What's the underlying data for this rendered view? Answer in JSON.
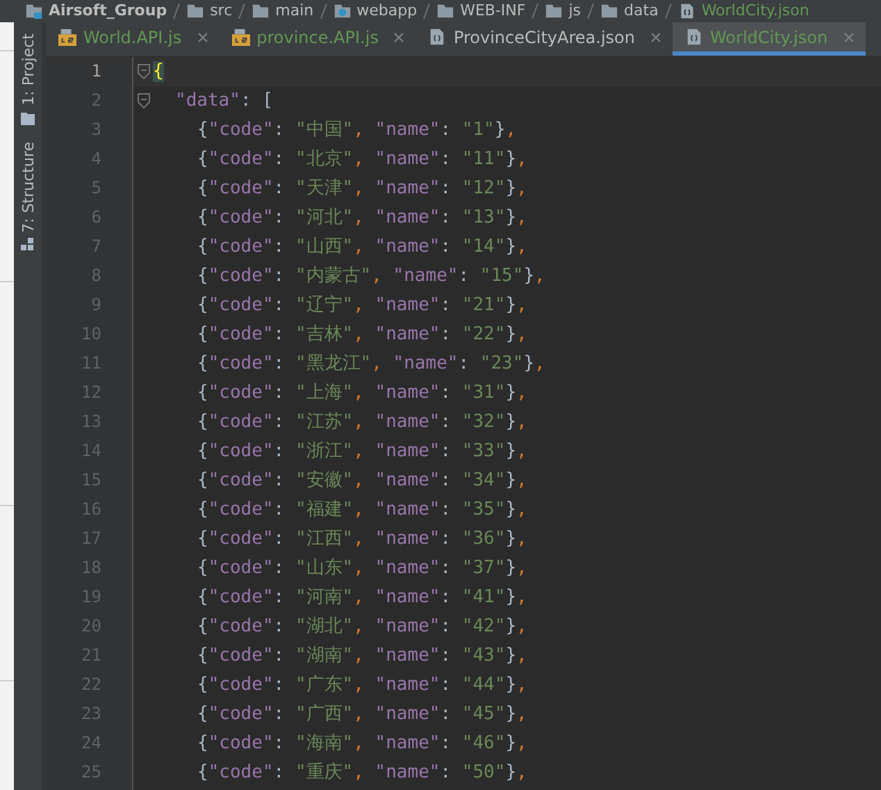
{
  "breadcrumb": [
    {
      "kind": "module",
      "label": "Airsoft_Group"
    },
    {
      "kind": "folder",
      "label": "src"
    },
    {
      "kind": "folder",
      "label": "main"
    },
    {
      "kind": "web",
      "label": "webapp"
    },
    {
      "kind": "folder",
      "label": "WEB-INF"
    },
    {
      "kind": "folder",
      "label": "js"
    },
    {
      "kind": "folder",
      "label": "data"
    },
    {
      "kind": "file",
      "label": "WorldCity.json"
    }
  ],
  "tool_strip": [
    {
      "kind": "project",
      "label": "1: Project"
    },
    {
      "kind": "structure",
      "label": "7: Structure"
    }
  ],
  "tabs": [
    {
      "kind": "js",
      "label": "World.API.js",
      "color": "#629755",
      "selected": false
    },
    {
      "kind": "js",
      "label": "province.API.js",
      "color": "#629755",
      "selected": false
    },
    {
      "kind": "json",
      "label": "ProvinceCityArea.json",
      "color": "#bbbbbb",
      "selected": false
    },
    {
      "kind": "json",
      "label": "WorldCity.json",
      "color": "#629755",
      "selected": true
    }
  ],
  "editor": {
    "lines": [
      {
        "number": "1",
        "current": true,
        "foldable": true,
        "kind": "root",
        "tokens": [
          {
            "kind": "brace-match",
            "text": "{"
          }
        ]
      },
      {
        "number": "2",
        "current": false,
        "foldable": true,
        "kind": "key",
        "tokens": [
          {
            "kind": "key",
            "text": "\"data\""
          },
          {
            "kind": "punct",
            "text": ": ["
          }
        ]
      },
      {
        "number": "3",
        "current": false,
        "foldable": false,
        "kind": "entry",
        "tokens": [
          {
            "kind": "punct",
            "text": "{"
          },
          {
            "kind": "key",
            "text": "\"code\""
          },
          {
            "kind": "punct",
            "text": ": "
          },
          {
            "kind": "string",
            "text": "\"中国\""
          },
          {
            "kind": "comma",
            "text": ", "
          },
          {
            "kind": "key",
            "text": "\"name\""
          },
          {
            "kind": "punct",
            "text": ": "
          },
          {
            "kind": "string",
            "text": "\"1\""
          },
          {
            "kind": "punct",
            "text": "}"
          },
          {
            "kind": "comma",
            "text": ","
          }
        ]
      },
      {
        "number": "4",
        "current": false,
        "foldable": false,
        "kind": "entry",
        "tokens": [
          {
            "kind": "punct",
            "text": "{"
          },
          {
            "kind": "key",
            "text": "\"code\""
          },
          {
            "kind": "punct",
            "text": ": "
          },
          {
            "kind": "string",
            "text": "\"北京\""
          },
          {
            "kind": "comma",
            "text": ", "
          },
          {
            "kind": "key",
            "text": "\"name\""
          },
          {
            "kind": "punct",
            "text": ": "
          },
          {
            "kind": "string",
            "text": "\"11\""
          },
          {
            "kind": "punct",
            "text": "}"
          },
          {
            "kind": "comma",
            "text": ","
          }
        ]
      },
      {
        "number": "5",
        "current": false,
        "foldable": false,
        "kind": "entry",
        "tokens": [
          {
            "kind": "punct",
            "text": "{"
          },
          {
            "kind": "key",
            "text": "\"code\""
          },
          {
            "kind": "punct",
            "text": ": "
          },
          {
            "kind": "string",
            "text": "\"天津\""
          },
          {
            "kind": "comma",
            "text": ", "
          },
          {
            "kind": "key",
            "text": "\"name\""
          },
          {
            "kind": "punct",
            "text": ": "
          },
          {
            "kind": "string",
            "text": "\"12\""
          },
          {
            "kind": "punct",
            "text": "}"
          },
          {
            "kind": "comma",
            "text": ","
          }
        ]
      },
      {
        "number": "6",
        "current": false,
        "foldable": false,
        "kind": "entry",
        "tokens": [
          {
            "kind": "punct",
            "text": "{"
          },
          {
            "kind": "key",
            "text": "\"code\""
          },
          {
            "kind": "punct",
            "text": ": "
          },
          {
            "kind": "string",
            "text": "\"河北\""
          },
          {
            "kind": "comma",
            "text": ", "
          },
          {
            "kind": "key",
            "text": "\"name\""
          },
          {
            "kind": "punct",
            "text": ": "
          },
          {
            "kind": "string",
            "text": "\"13\""
          },
          {
            "kind": "punct",
            "text": "}"
          },
          {
            "kind": "comma",
            "text": ","
          }
        ]
      },
      {
        "number": "7",
        "current": false,
        "foldable": false,
        "kind": "entry",
        "tokens": [
          {
            "kind": "punct",
            "text": "{"
          },
          {
            "kind": "key",
            "text": "\"code\""
          },
          {
            "kind": "punct",
            "text": ": "
          },
          {
            "kind": "string",
            "text": "\"山西\""
          },
          {
            "kind": "comma",
            "text": ", "
          },
          {
            "kind": "key",
            "text": "\"name\""
          },
          {
            "kind": "punct",
            "text": ": "
          },
          {
            "kind": "string",
            "text": "\"14\""
          },
          {
            "kind": "punct",
            "text": "}"
          },
          {
            "kind": "comma",
            "text": ","
          }
        ]
      },
      {
        "number": "8",
        "current": false,
        "foldable": false,
        "kind": "entry",
        "tokens": [
          {
            "kind": "punct",
            "text": "{"
          },
          {
            "kind": "key",
            "text": "\"code\""
          },
          {
            "kind": "punct",
            "text": ": "
          },
          {
            "kind": "string",
            "text": "\"内蒙古\""
          },
          {
            "kind": "comma",
            "text": ", "
          },
          {
            "kind": "key",
            "text": "\"name\""
          },
          {
            "kind": "punct",
            "text": ": "
          },
          {
            "kind": "string",
            "text": "\"15\""
          },
          {
            "kind": "punct",
            "text": "}"
          },
          {
            "kind": "comma",
            "text": ","
          }
        ]
      },
      {
        "number": "9",
        "current": false,
        "foldable": false,
        "kind": "entry",
        "tokens": [
          {
            "kind": "punct",
            "text": "{"
          },
          {
            "kind": "key",
            "text": "\"code\""
          },
          {
            "kind": "punct",
            "text": ": "
          },
          {
            "kind": "string",
            "text": "\"辽宁\""
          },
          {
            "kind": "comma",
            "text": ", "
          },
          {
            "kind": "key",
            "text": "\"name\""
          },
          {
            "kind": "punct",
            "text": ": "
          },
          {
            "kind": "string",
            "text": "\"21\""
          },
          {
            "kind": "punct",
            "text": "}"
          },
          {
            "kind": "comma",
            "text": ","
          }
        ]
      },
      {
        "number": "10",
        "current": false,
        "foldable": false,
        "kind": "entry",
        "tokens": [
          {
            "kind": "punct",
            "text": "{"
          },
          {
            "kind": "key",
            "text": "\"code\""
          },
          {
            "kind": "punct",
            "text": ": "
          },
          {
            "kind": "string",
            "text": "\"吉林\""
          },
          {
            "kind": "comma",
            "text": ", "
          },
          {
            "kind": "key",
            "text": "\"name\""
          },
          {
            "kind": "punct",
            "text": ": "
          },
          {
            "kind": "string",
            "text": "\"22\""
          },
          {
            "kind": "punct",
            "text": "}"
          },
          {
            "kind": "comma",
            "text": ","
          }
        ]
      },
      {
        "number": "11",
        "current": false,
        "foldable": false,
        "kind": "entry",
        "tokens": [
          {
            "kind": "punct",
            "text": "{"
          },
          {
            "kind": "key",
            "text": "\"code\""
          },
          {
            "kind": "punct",
            "text": ": "
          },
          {
            "kind": "string",
            "text": "\"黑龙江\""
          },
          {
            "kind": "comma",
            "text": ", "
          },
          {
            "kind": "key",
            "text": "\"name\""
          },
          {
            "kind": "punct",
            "text": ": "
          },
          {
            "kind": "string",
            "text": "\"23\""
          },
          {
            "kind": "punct",
            "text": "}"
          },
          {
            "kind": "comma",
            "text": ","
          }
        ]
      },
      {
        "number": "12",
        "current": false,
        "foldable": false,
        "kind": "entry",
        "tokens": [
          {
            "kind": "punct",
            "text": "{"
          },
          {
            "kind": "key",
            "text": "\"code\""
          },
          {
            "kind": "punct",
            "text": ": "
          },
          {
            "kind": "string",
            "text": "\"上海\""
          },
          {
            "kind": "comma",
            "text": ", "
          },
          {
            "kind": "key",
            "text": "\"name\""
          },
          {
            "kind": "punct",
            "text": ": "
          },
          {
            "kind": "string",
            "text": "\"31\""
          },
          {
            "kind": "punct",
            "text": "}"
          },
          {
            "kind": "comma",
            "text": ","
          }
        ]
      },
      {
        "number": "13",
        "current": false,
        "foldable": false,
        "kind": "entry",
        "tokens": [
          {
            "kind": "punct",
            "text": "{"
          },
          {
            "kind": "key",
            "text": "\"code\""
          },
          {
            "kind": "punct",
            "text": ": "
          },
          {
            "kind": "string",
            "text": "\"江苏\""
          },
          {
            "kind": "comma",
            "text": ", "
          },
          {
            "kind": "key",
            "text": "\"name\""
          },
          {
            "kind": "punct",
            "text": ": "
          },
          {
            "kind": "string",
            "text": "\"32\""
          },
          {
            "kind": "punct",
            "text": "}"
          },
          {
            "kind": "comma",
            "text": ","
          }
        ]
      },
      {
        "number": "14",
        "current": false,
        "foldable": false,
        "kind": "entry",
        "tokens": [
          {
            "kind": "punct",
            "text": "{"
          },
          {
            "kind": "key",
            "text": "\"code\""
          },
          {
            "kind": "punct",
            "text": ": "
          },
          {
            "kind": "string",
            "text": "\"浙江\""
          },
          {
            "kind": "comma",
            "text": ", "
          },
          {
            "kind": "key",
            "text": "\"name\""
          },
          {
            "kind": "punct",
            "text": ": "
          },
          {
            "kind": "string",
            "text": "\"33\""
          },
          {
            "kind": "punct",
            "text": "}"
          },
          {
            "kind": "comma",
            "text": ","
          }
        ]
      },
      {
        "number": "15",
        "current": false,
        "foldable": false,
        "kind": "entry",
        "tokens": [
          {
            "kind": "punct",
            "text": "{"
          },
          {
            "kind": "key",
            "text": "\"code\""
          },
          {
            "kind": "punct",
            "text": ": "
          },
          {
            "kind": "string",
            "text": "\"安徽\""
          },
          {
            "kind": "comma",
            "text": ", "
          },
          {
            "kind": "key",
            "text": "\"name\""
          },
          {
            "kind": "punct",
            "text": ": "
          },
          {
            "kind": "string",
            "text": "\"34\""
          },
          {
            "kind": "punct",
            "text": "}"
          },
          {
            "kind": "comma",
            "text": ","
          }
        ]
      },
      {
        "number": "16",
        "current": false,
        "foldable": false,
        "kind": "entry",
        "tokens": [
          {
            "kind": "punct",
            "text": "{"
          },
          {
            "kind": "key",
            "text": "\"code\""
          },
          {
            "kind": "punct",
            "text": ": "
          },
          {
            "kind": "string",
            "text": "\"福建\""
          },
          {
            "kind": "comma",
            "text": ", "
          },
          {
            "kind": "key",
            "text": "\"name\""
          },
          {
            "kind": "punct",
            "text": ": "
          },
          {
            "kind": "string",
            "text": "\"35\""
          },
          {
            "kind": "punct",
            "text": "}"
          },
          {
            "kind": "comma",
            "text": ","
          }
        ]
      },
      {
        "number": "17",
        "current": false,
        "foldable": false,
        "kind": "entry",
        "tokens": [
          {
            "kind": "punct",
            "text": "{"
          },
          {
            "kind": "key",
            "text": "\"code\""
          },
          {
            "kind": "punct",
            "text": ": "
          },
          {
            "kind": "string",
            "text": "\"江西\""
          },
          {
            "kind": "comma",
            "text": ", "
          },
          {
            "kind": "key",
            "text": "\"name\""
          },
          {
            "kind": "punct",
            "text": ": "
          },
          {
            "kind": "string",
            "text": "\"36\""
          },
          {
            "kind": "punct",
            "text": "}"
          },
          {
            "kind": "comma",
            "text": ","
          }
        ]
      },
      {
        "number": "18",
        "current": false,
        "foldable": false,
        "kind": "entry",
        "tokens": [
          {
            "kind": "punct",
            "text": "{"
          },
          {
            "kind": "key",
            "text": "\"code\""
          },
          {
            "kind": "punct",
            "text": ": "
          },
          {
            "kind": "string",
            "text": "\"山东\""
          },
          {
            "kind": "comma",
            "text": ", "
          },
          {
            "kind": "key",
            "text": "\"name\""
          },
          {
            "kind": "punct",
            "text": ": "
          },
          {
            "kind": "string",
            "text": "\"37\""
          },
          {
            "kind": "punct",
            "text": "}"
          },
          {
            "kind": "comma",
            "text": ","
          }
        ]
      },
      {
        "number": "19",
        "current": false,
        "foldable": false,
        "kind": "entry",
        "tokens": [
          {
            "kind": "punct",
            "text": "{"
          },
          {
            "kind": "key",
            "text": "\"code\""
          },
          {
            "kind": "punct",
            "text": ": "
          },
          {
            "kind": "string",
            "text": "\"河南\""
          },
          {
            "kind": "comma",
            "text": ", "
          },
          {
            "kind": "key",
            "text": "\"name\""
          },
          {
            "kind": "punct",
            "text": ": "
          },
          {
            "kind": "string",
            "text": "\"41\""
          },
          {
            "kind": "punct",
            "text": "}"
          },
          {
            "kind": "comma",
            "text": ","
          }
        ]
      },
      {
        "number": "20",
        "current": false,
        "foldable": false,
        "kind": "entry",
        "tokens": [
          {
            "kind": "punct",
            "text": "{"
          },
          {
            "kind": "key",
            "text": "\"code\""
          },
          {
            "kind": "punct",
            "text": ": "
          },
          {
            "kind": "string",
            "text": "\"湖北\""
          },
          {
            "kind": "comma",
            "text": ", "
          },
          {
            "kind": "key",
            "text": "\"name\""
          },
          {
            "kind": "punct",
            "text": ": "
          },
          {
            "kind": "string",
            "text": "\"42\""
          },
          {
            "kind": "punct",
            "text": "}"
          },
          {
            "kind": "comma",
            "text": ","
          }
        ]
      },
      {
        "number": "21",
        "current": false,
        "foldable": false,
        "kind": "entry",
        "tokens": [
          {
            "kind": "punct",
            "text": "{"
          },
          {
            "kind": "key",
            "text": "\"code\""
          },
          {
            "kind": "punct",
            "text": ": "
          },
          {
            "kind": "string",
            "text": "\"湖南\""
          },
          {
            "kind": "comma",
            "text": ", "
          },
          {
            "kind": "key",
            "text": "\"name\""
          },
          {
            "kind": "punct",
            "text": ": "
          },
          {
            "kind": "string",
            "text": "\"43\""
          },
          {
            "kind": "punct",
            "text": "}"
          },
          {
            "kind": "comma",
            "text": ","
          }
        ]
      },
      {
        "number": "22",
        "current": false,
        "foldable": false,
        "kind": "entry",
        "tokens": [
          {
            "kind": "punct",
            "text": "{"
          },
          {
            "kind": "key",
            "text": "\"code\""
          },
          {
            "kind": "punct",
            "text": ": "
          },
          {
            "kind": "string",
            "text": "\"广东\""
          },
          {
            "kind": "comma",
            "text": ", "
          },
          {
            "kind": "key",
            "text": "\"name\""
          },
          {
            "kind": "punct",
            "text": ": "
          },
          {
            "kind": "string",
            "text": "\"44\""
          },
          {
            "kind": "punct",
            "text": "}"
          },
          {
            "kind": "comma",
            "text": ","
          }
        ]
      },
      {
        "number": "23",
        "current": false,
        "foldable": false,
        "kind": "entry",
        "tokens": [
          {
            "kind": "punct",
            "text": "{"
          },
          {
            "kind": "key",
            "text": "\"code\""
          },
          {
            "kind": "punct",
            "text": ": "
          },
          {
            "kind": "string",
            "text": "\"广西\""
          },
          {
            "kind": "comma",
            "text": ", "
          },
          {
            "kind": "key",
            "text": "\"name\""
          },
          {
            "kind": "punct",
            "text": ": "
          },
          {
            "kind": "string",
            "text": "\"45\""
          },
          {
            "kind": "punct",
            "text": "}"
          },
          {
            "kind": "comma",
            "text": ","
          }
        ]
      },
      {
        "number": "24",
        "current": false,
        "foldable": false,
        "kind": "entry",
        "tokens": [
          {
            "kind": "punct",
            "text": "{"
          },
          {
            "kind": "key",
            "text": "\"code\""
          },
          {
            "kind": "punct",
            "text": ": "
          },
          {
            "kind": "string",
            "text": "\"海南\""
          },
          {
            "kind": "comma",
            "text": ", "
          },
          {
            "kind": "key",
            "text": "\"name\""
          },
          {
            "kind": "punct",
            "text": ": "
          },
          {
            "kind": "string",
            "text": "\"46\""
          },
          {
            "kind": "punct",
            "text": "}"
          },
          {
            "kind": "comma",
            "text": ","
          }
        ]
      },
      {
        "number": "25",
        "current": false,
        "foldable": false,
        "kind": "entry",
        "tokens": [
          {
            "kind": "punct",
            "text": "{"
          },
          {
            "kind": "key",
            "text": "\"code\""
          },
          {
            "kind": "punct",
            "text": ": "
          },
          {
            "kind": "string",
            "text": "\"重庆\""
          },
          {
            "kind": "comma",
            "text": ", "
          },
          {
            "kind": "key",
            "text": "\"name\""
          },
          {
            "kind": "punct",
            "text": ": "
          },
          {
            "kind": "string",
            "text": "\"50\""
          },
          {
            "kind": "punct",
            "text": "}"
          },
          {
            "kind": "comma",
            "text": ","
          }
        ]
      }
    ]
  }
}
